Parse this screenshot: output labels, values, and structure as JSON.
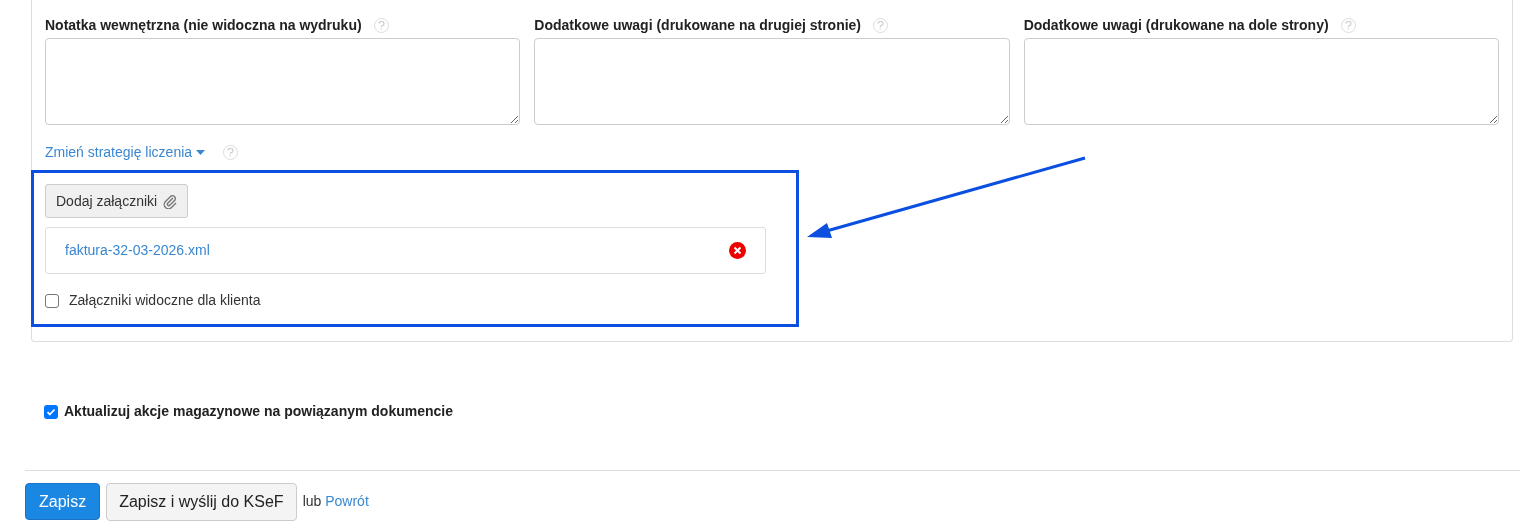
{
  "notes": [
    {
      "label": "Notatka wewnętrzna (nie widoczna na wydruku)"
    },
    {
      "label": "Dodatkowe uwagi (drukowane na drugiej stronie)"
    },
    {
      "label": "Dodatkowe uwagi (drukowane na dole strony)"
    }
  ],
  "strategy_link": "Zmień strategię liczenia",
  "attachments": {
    "add_button": "Dodaj załączniki",
    "files": [
      {
        "name": "faktura-32-03-2026.xml"
      }
    ],
    "visible_to_client": {
      "label": "Załączniki widoczne dla klienta",
      "checked": false
    }
  },
  "update_stock": {
    "label": "Aktualizuj akcje magazynowe na powiązanym dokumencie",
    "checked": true
  },
  "actions": {
    "save": "Zapisz",
    "save_send": "Zapisz i wyślij do KSeF",
    "or": "lub",
    "back": "Powrót"
  }
}
